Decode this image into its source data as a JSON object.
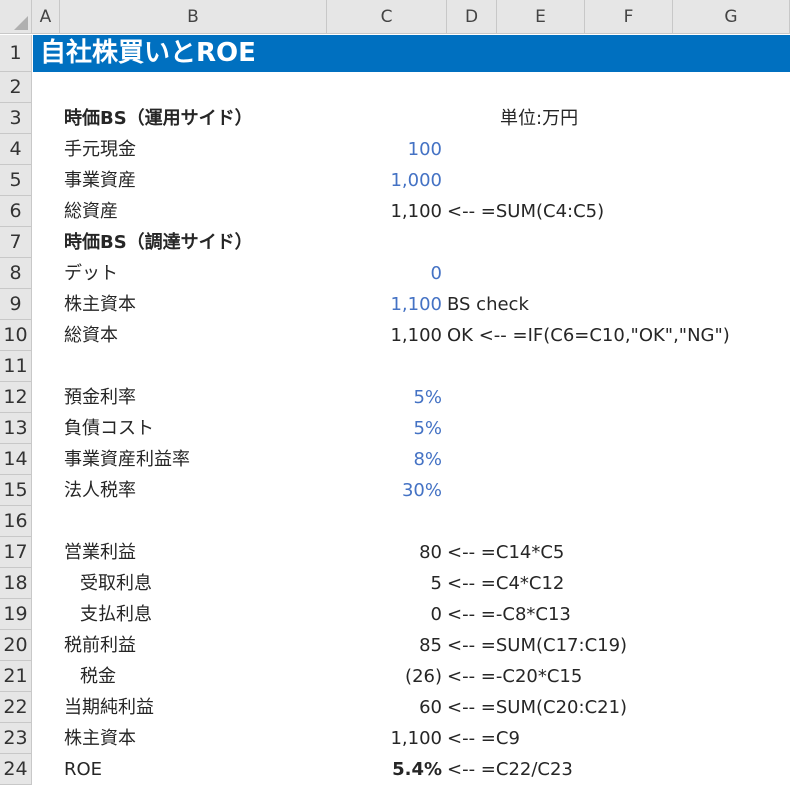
{
  "columns": [
    "A",
    "B",
    "C",
    "D",
    "E",
    "F",
    "G"
  ],
  "title": "自社株買いとROE",
  "unit": "単位:万円",
  "rows": [
    {
      "num": "1"
    },
    {
      "num": "2"
    },
    {
      "num": "3",
      "label": "時価BS（運用サイド）",
      "bold": true
    },
    {
      "num": "4",
      "label": "手元現金",
      "value": "100",
      "blue": true
    },
    {
      "num": "5",
      "label": "事業資産",
      "value": "1,000",
      "blue": true
    },
    {
      "num": "6",
      "label": "総資産",
      "value": "1,100",
      "note": "<-- =SUM(C4:C5)"
    },
    {
      "num": "7",
      "label": "時価BS（調達サイド）",
      "bold": true
    },
    {
      "num": "8",
      "label": "デット",
      "value": "0",
      "blue": true
    },
    {
      "num": "9",
      "label": "株主資本",
      "value": "1,100",
      "blue": true,
      "note": " BS check"
    },
    {
      "num": "10",
      "label": "総資本",
      "value": "1,100",
      "note": "  OK   <-- =IF(C6=C10,\"OK\",\"NG\")"
    },
    {
      "num": "11"
    },
    {
      "num": "12",
      "label": "預金利率",
      "value": "5%",
      "blue": true
    },
    {
      "num": "13",
      "label": "負債コスト",
      "value": "5%",
      "blue": true
    },
    {
      "num": "14",
      "label": "事業資産利益率",
      "value": "8%",
      "blue": true
    },
    {
      "num": "15",
      "label": "法人税率",
      "value": "30%",
      "blue": true
    },
    {
      "num": "16"
    },
    {
      "num": "17",
      "label": "営業利益",
      "value": "80",
      "note": "<-- =C14*C5"
    },
    {
      "num": "18",
      "label": "受取利息",
      "indent": true,
      "value": "5",
      "note": "<-- =C4*C12"
    },
    {
      "num": "19",
      "label": "支払利息",
      "indent": true,
      "value": "0",
      "note": "<-- =-C8*C13"
    },
    {
      "num": "20",
      "label": "税前利益",
      "value": "85",
      "note": "<-- =SUM(C17:C19)"
    },
    {
      "num": "21",
      "label": "税金",
      "indent": true,
      "value": "(26)",
      "note": "<-- =-C20*C15"
    },
    {
      "num": "22",
      "label": "当期純利益",
      "value": "60",
      "note": "<-- =SUM(C20:C21)"
    },
    {
      "num": "23",
      "label": "株主資本",
      "value": "1,100",
      "note": "<-- =C9"
    },
    {
      "num": "24",
      "label": "ROE",
      "value": "5.4%",
      "bold_value": true,
      "note": "<-- =C22/C23"
    }
  ]
}
